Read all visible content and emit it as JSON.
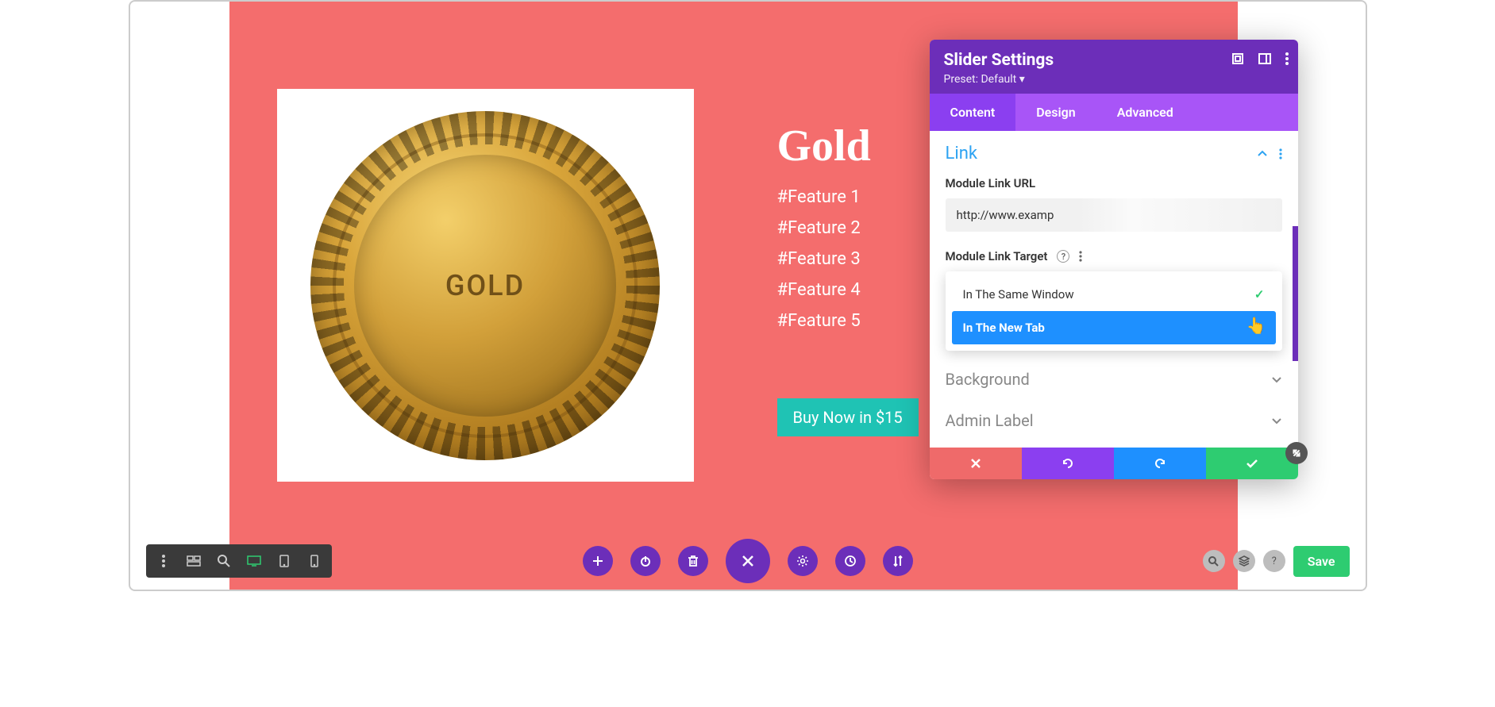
{
  "product": {
    "title": "Gold",
    "coin_text": "GOLD",
    "features": [
      "#Feature 1",
      "#Feature 2",
      "#Feature 3",
      "#Feature 4",
      "#Feature 5"
    ],
    "cta": "Buy Now in $15"
  },
  "panel": {
    "title": "Slider Settings",
    "preset": "Preset: Default ▾",
    "tabs": [
      "Content",
      "Design",
      "Advanced"
    ],
    "active_tab": 0,
    "section": {
      "title": "Link",
      "url_label": "Module Link URL",
      "url_value": "http://www.examp",
      "target_label": "Module Link Target",
      "options": [
        "In The Same Window",
        "In The New Tab"
      ],
      "selected_index": 0,
      "hover_index": 1
    },
    "collapsed": [
      "Background",
      "Admin Label"
    ]
  },
  "bottom": {
    "save": "Save"
  },
  "colors": {
    "canvas": "#f46d6d",
    "primary": "#6c2eb9",
    "accent": "#2ecc71"
  }
}
